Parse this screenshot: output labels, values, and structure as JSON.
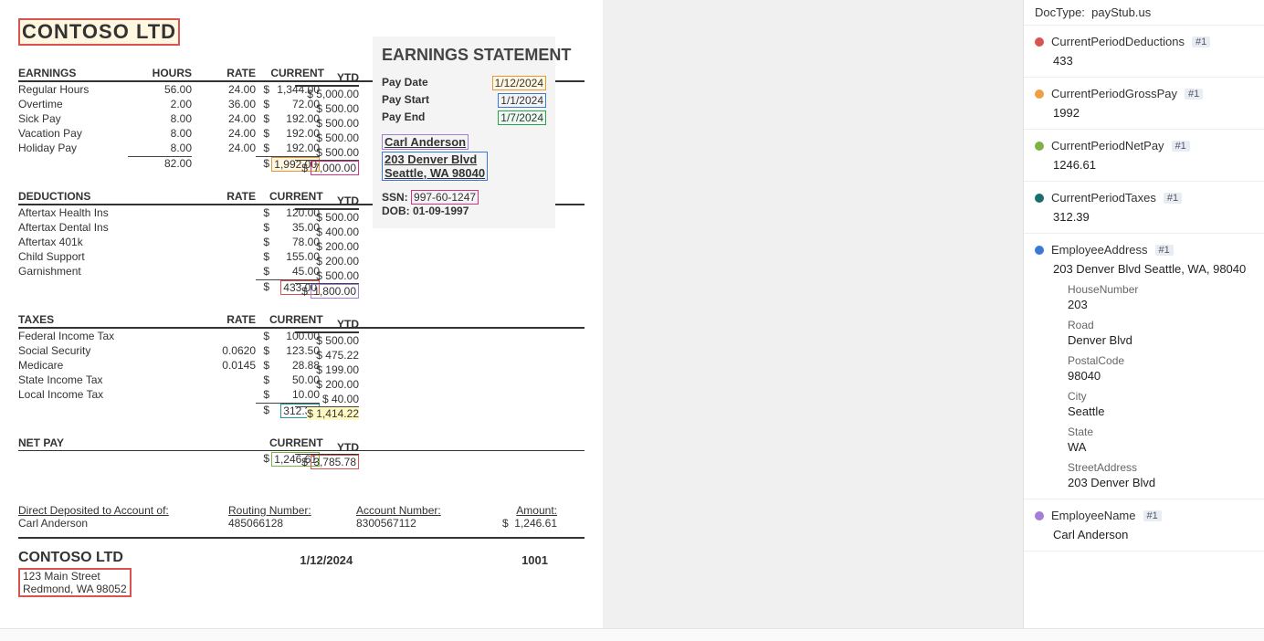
{
  "doc": {
    "company": "CONTOSO LTD",
    "stmt_title": "EARNINGS STATEMENT",
    "pay_date_label": "Pay Date",
    "pay_date": "1/12/2024",
    "pay_start_label": "Pay Start",
    "pay_start": "1/1/2024",
    "pay_end_label": "Pay End",
    "pay_end": "1/7/2024",
    "employee_name": "Carl Anderson",
    "addr1": "203 Denver Blvd",
    "addr2": "Seattle, WA 98040",
    "ssn_label": "SSN:",
    "ssn": "997-60-1247",
    "dob": "DOB: 01-09-1997",
    "earnings": {
      "header": {
        "c0": "EARNINGS",
        "c1": "HOURS",
        "c2": "RATE",
        "c3": "CURRENT",
        "c4": "YTD"
      },
      "rows": [
        {
          "label": "Regular Hours",
          "hours": "56.00",
          "rate": "24.00",
          "cur": "1,344.00",
          "ytd": "5,000.00"
        },
        {
          "label": "Overtime",
          "hours": "2.00",
          "rate": "36.00",
          "cur": "72.00",
          "ytd": "500.00"
        },
        {
          "label": "Sick Pay",
          "hours": "8.00",
          "rate": "24.00",
          "cur": "192.00",
          "ytd": "500.00"
        },
        {
          "label": "Vacation Pay",
          "hours": "8.00",
          "rate": "24.00",
          "cur": "192.00",
          "ytd": "500.00"
        },
        {
          "label": "Holiday Pay",
          "hours": "8.00",
          "rate": "24.00",
          "cur": "192.00",
          "ytd": "500.00"
        }
      ],
      "hours_total": "82.00",
      "cur_total": "1,992.00",
      "ytd_total": "7,000.00"
    },
    "deductions": {
      "header": {
        "c0": "DEDUCTIONS",
        "c2": "RATE",
        "c3": "CURRENT",
        "c4": "YTD"
      },
      "rows": [
        {
          "label": "Aftertax Health Ins",
          "rate": "",
          "cur": "120.00",
          "ytd": "500.00"
        },
        {
          "label": "Aftertax Dental Ins",
          "rate": "",
          "cur": "35.00",
          "ytd": "400.00"
        },
        {
          "label": "Aftertax 401k",
          "rate": "",
          "cur": "78.00",
          "ytd": "200.00"
        },
        {
          "label": "Child Support",
          "rate": "",
          "cur": "155.00",
          "ytd": "200.00"
        },
        {
          "label": "Garnishment",
          "rate": "",
          "cur": "45.00",
          "ytd": "500.00"
        }
      ],
      "cur_total": "433.00",
      "ytd_total": "1,800.00"
    },
    "taxes": {
      "header": {
        "c0": "TAXES",
        "c2": "RATE",
        "c3": "CURRENT",
        "c4": "YTD"
      },
      "rows": [
        {
          "label": "Federal Income Tax",
          "rate": "",
          "cur": "100.00",
          "ytd": "500.00"
        },
        {
          "label": "Social Security",
          "rate": "0.0620",
          "cur": "123.50",
          "ytd": "475.22"
        },
        {
          "label": "Medicare",
          "rate": "0.0145",
          "cur": "28.88",
          "ytd": "199.00"
        },
        {
          "label": "State Income Tax",
          "rate": "",
          "cur": "50.00",
          "ytd": "200.00"
        },
        {
          "label": "Local Income Tax",
          "rate": "",
          "cur": "10.00",
          "ytd": "40.00"
        }
      ],
      "cur_total": "312.39",
      "ytd_total": "1,414.22"
    },
    "netpay": {
      "label": "NET PAY",
      "cur_header": "CURRENT",
      "ytd_header": "YTD",
      "cur": "1,246.61",
      "ytd": "3,785.78"
    },
    "deposit": {
      "to_label": "Direct Deposited to Account of:",
      "to": "Carl Anderson",
      "routing_label": "Routing Number:",
      "routing": "485066128",
      "acct_label": "Account Number:",
      "acct": "8300567112",
      "amt_label": "Amount:",
      "amt": "1,246.61"
    },
    "footer": {
      "company": "CONTOSO LTD",
      "addr1": "123 Main Street",
      "addr2": "Redmond, WA 98052",
      "date": "1/12/2024",
      "check": "1001"
    },
    "dollar": "$"
  },
  "panel": {
    "doctype_label": "DocType:",
    "doctype": "payStub.us",
    "fields": [
      {
        "color": "#d9534f",
        "name": "CurrentPeriodDeductions",
        "badge": "#1",
        "value": "433"
      },
      {
        "color": "#f0a043",
        "name": "CurrentPeriodGrossPay",
        "badge": "#1",
        "value": "1992"
      },
      {
        "color": "#7cb342",
        "name": "CurrentPeriodNetPay",
        "badge": "#1",
        "value": "1246.61"
      },
      {
        "color": "#1a6e6e",
        "name": "CurrentPeriodTaxes",
        "badge": "#1",
        "value": "312.39"
      },
      {
        "color": "#3c78d8",
        "name": "EmployeeAddress",
        "badge": "#1",
        "value": "203 Denver Blvd Seattle, WA, 98040",
        "subs": [
          {
            "label": "HouseNumber",
            "value": "203"
          },
          {
            "label": "Road",
            "value": "Denver Blvd"
          },
          {
            "label": "PostalCode",
            "value": "98040"
          },
          {
            "label": "City",
            "value": "Seattle"
          },
          {
            "label": "State",
            "value": "WA"
          },
          {
            "label": "StreetAddress",
            "value": "203 Denver Blvd"
          }
        ]
      },
      {
        "color": "#a37ed6",
        "name": "EmployeeName",
        "badge": "#1",
        "value": "Carl Anderson"
      }
    ]
  }
}
